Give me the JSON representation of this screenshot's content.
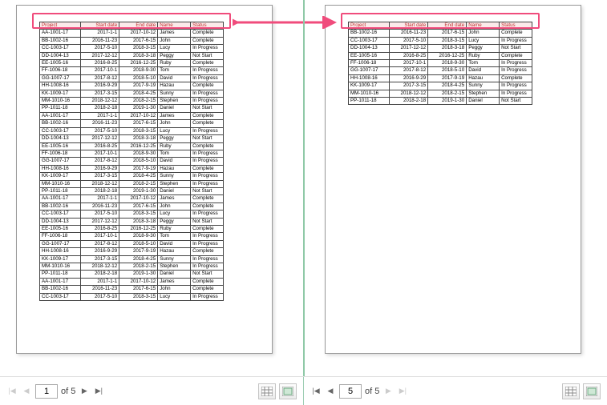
{
  "headers": [
    "Project",
    "Start date",
    "End date",
    "Name",
    "Status"
  ],
  "rows_full": [
    [
      "AA-1001-17",
      "2017-1-1",
      "2017-10-12",
      "James",
      "Complete"
    ],
    [
      "BB-1002-16",
      "2016-11-23",
      "2017-6-15",
      "John",
      "Complete"
    ],
    [
      "CC-1003-17",
      "2017-5-10",
      "2018-3-15",
      "Lucy",
      "In Progress"
    ],
    [
      "DD-1004-13",
      "2017-12-12",
      "2018-3-18",
      "Peggy",
      "Not Start"
    ],
    [
      "EE-1005-16",
      "2016-8-25",
      "2016-12-25",
      "Ruby",
      "Complete"
    ],
    [
      "FF-1006-18",
      "2017-10-1",
      "2018-9-30",
      "Tom",
      "In Progress"
    ],
    [
      "GG-1007-17",
      "2017-8-12",
      "2018-5-10",
      "David",
      "In Progress"
    ],
    [
      "HH-1008-16",
      "2016-9-29",
      "2017-9-19",
      "Hazau",
      "Complete"
    ],
    [
      "KK-1009-17",
      "2017-3-15",
      "2018-4-25",
      "Sunny",
      "In Progress"
    ],
    [
      "MM-1010-16",
      "2018-12-12",
      "2018-2-15",
      "Stephen",
      "In Progress"
    ],
    [
      "PP-1011-18",
      "2018-2-18",
      "2019-1-30",
      "Daniel",
      "Not Start"
    ],
    [
      "AA-1001-17",
      "2017-1-1",
      "2017-10-12",
      "James",
      "Complete"
    ],
    [
      "BB-1002-16",
      "2016-11-23",
      "2017-6-15",
      "John",
      "Complete"
    ],
    [
      "CC-1003-17",
      "2017-5-10",
      "2018-3-15",
      "Lucy",
      "In Progress"
    ],
    [
      "DD-1004-13",
      "2017-12-12",
      "2018-3-18",
      "Peggy",
      "Not Start"
    ],
    [
      "EE-1005-16",
      "2016-8-25",
      "2016-12-25",
      "Ruby",
      "Complete"
    ],
    [
      "FF-1006-18",
      "2017-10-1",
      "2018-9-30",
      "Tom",
      "In Progress"
    ],
    [
      "GG-1007-17",
      "2017-8-12",
      "2018-5-10",
      "David",
      "In Progress"
    ],
    [
      "HH-1008-16",
      "2016-9-29",
      "2017-9-19",
      "Hazau",
      "Complete"
    ],
    [
      "KK-1009-17",
      "2017-3-15",
      "2018-4-25",
      "Sunny",
      "In Progress"
    ],
    [
      "MM-1010-16",
      "2018-12-12",
      "2018-2-15",
      "Stephen",
      "In Progress"
    ],
    [
      "PP-1011-18",
      "2018-2-18",
      "2019-1-30",
      "Daniel",
      "Not Start"
    ],
    [
      "AA-1001-17",
      "2017-1-1",
      "2017-10-12",
      "James",
      "Complete"
    ],
    [
      "BB-1002-16",
      "2016-11-23",
      "2017-6-15",
      "John",
      "Complete"
    ],
    [
      "CC-1003-17",
      "2017-5-10",
      "2018-3-15",
      "Lucy",
      "In Progress"
    ],
    [
      "DD-1004-13",
      "2017-12-12",
      "2018-3-18",
      "Peggy",
      "Not Start"
    ],
    [
      "EE-1005-16",
      "2016-8-25",
      "2016-12-25",
      "Ruby",
      "Complete"
    ],
    [
      "FF-1006-18",
      "2017-10-1",
      "2018-9-30",
      "Tom",
      "In Progress"
    ],
    [
      "GG-1007-17",
      "2017-8-12",
      "2018-5-10",
      "David",
      "In Progress"
    ],
    [
      "HH-1008-16",
      "2016-9-29",
      "2017-9-19",
      "Hazau",
      "Complete"
    ],
    [
      "KK-1009-17",
      "2017-3-15",
      "2018-4-25",
      "Sunny",
      "In Progress"
    ],
    [
      "MM-1010-16",
      "2018-12-12",
      "2018-2-15",
      "Stephen",
      "In Progress"
    ],
    [
      "PP-1011-18",
      "2018-2-18",
      "2019-1-30",
      "Daniel",
      "Not Start"
    ],
    [
      "AA-1001-17",
      "2017-1-1",
      "2017-10-12",
      "James",
      "Complete"
    ],
    [
      "BB-1002-16",
      "2016-11-23",
      "2017-6-15",
      "John",
      "Complete"
    ],
    [
      "CC-1003-17",
      "2017-5-10",
      "2018-3-15",
      "Lucy",
      "In Progress"
    ]
  ],
  "rows_page5": [
    [
      "BB-1002-16",
      "2016-11-23",
      "2017-6-15",
      "John",
      "Complete"
    ],
    [
      "CC-1003-17",
      "2017-5-10",
      "2018-3-15",
      "Lucy",
      "In Progress"
    ],
    [
      "DD-1004-13",
      "2017-12-12",
      "2018-3-18",
      "Peggy",
      "Not Start"
    ],
    [
      "EE-1005-16",
      "2016-8-25",
      "2016-12-25",
      "Ruby",
      "Complete"
    ],
    [
      "FF-1006-18",
      "2017-10-1",
      "2018-9-30",
      "Tom",
      "In Progress"
    ],
    [
      "GG-1007-17",
      "2017-8-12",
      "2018-5-10",
      "David",
      "In Progress"
    ],
    [
      "HH-1008-16",
      "2016-9-29",
      "2017-9-19",
      "Hazau",
      "Complete"
    ],
    [
      "KK-1009-17",
      "2017-3-15",
      "2018-4-25",
      "Sunny",
      "In Progress"
    ],
    [
      "MM-1010-16",
      "2018-12-12",
      "2018-2-15",
      "Stephen",
      "In Progress"
    ],
    [
      "PP-1011-18",
      "2018-2-18",
      "2019-1-30",
      "Daniel",
      "Not Start"
    ]
  ],
  "pager": {
    "left_value": "1",
    "right_value": "5",
    "of_label": "of 5"
  }
}
